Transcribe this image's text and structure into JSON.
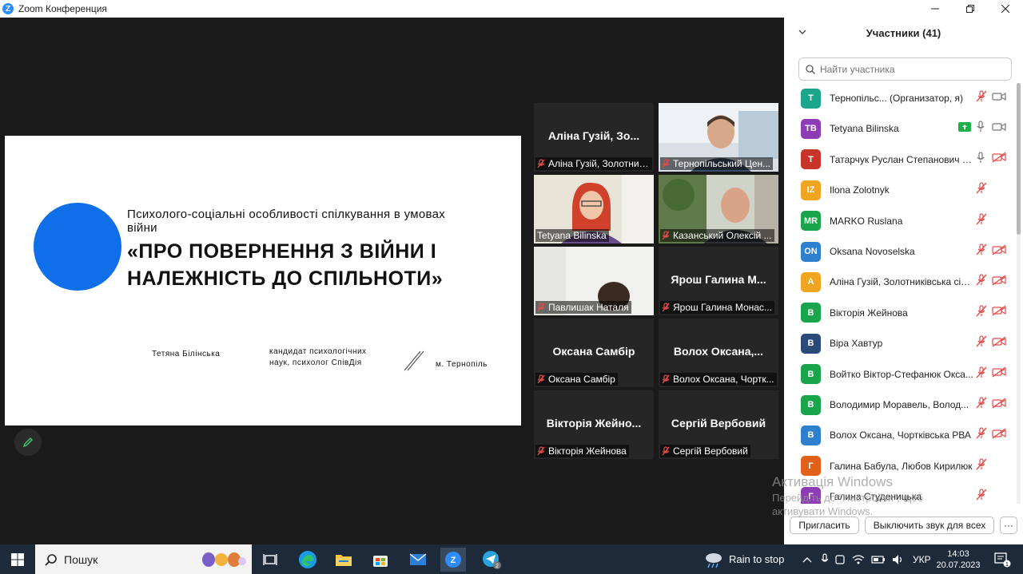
{
  "window": {
    "title": "Zoom Конференция"
  },
  "slide": {
    "subtitle": "Психолого-соціальні особливості спілкування в умовах війни",
    "title": "«ПРО ПОВЕРНЕННЯ З ВІЙНИ І НАЛЕЖНІСТЬ ДО СПІЛЬНОТИ»",
    "author": "Тетяна Білінська",
    "degree": "кандидат психологічних наук, психолог СпівДія",
    "city": "м. Тернопіль",
    "circle_color": "#0e6fe8"
  },
  "tiles": [
    {
      "display_name": "Аліна Гузій, Зо...",
      "label": "Аліна Гузій, Золотник...",
      "muted": true,
      "video": false
    },
    {
      "display_name": "",
      "label": "Тернопільський Цен...",
      "muted": true,
      "video": true
    },
    {
      "display_name": "",
      "label": "Tetyana Bilinska",
      "muted": false,
      "video": true,
      "active": true
    },
    {
      "display_name": "",
      "label": "Казанський Олексій ...",
      "muted": true,
      "video": true
    },
    {
      "display_name": "",
      "label": "Павлишак Наталя",
      "muted": true,
      "video": true
    },
    {
      "display_name": "Ярош Галина М...",
      "label": "Ярош Галина Монас...",
      "muted": true,
      "video": false
    },
    {
      "display_name": "Оксана Самбір",
      "label": "Оксана Самбір",
      "muted": true,
      "video": false
    },
    {
      "display_name": "Волох Оксана,...",
      "label": "Волох Оксана, Чортк...",
      "muted": true,
      "video": false
    },
    {
      "display_name": "Вікторія Жейно...",
      "label": "Вікторія Жейнова",
      "muted": true,
      "video": false
    },
    {
      "display_name": "Сергій Вербовий",
      "label": "Сергій Вербовий",
      "muted": true,
      "video": false
    }
  ],
  "panel": {
    "title": "Участники (41)",
    "search_placeholder": "Найти участника",
    "participants": [
      {
        "initials": "Т",
        "color": "#1aa58c",
        "name": "Тернопільс...  (Организатор, я)",
        "mic": "muted",
        "cam": "on"
      },
      {
        "initials": "TB",
        "color": "#8e3cb5",
        "name": "Tetyana Bilinska",
        "share": true,
        "mic": "on",
        "cam": "on"
      },
      {
        "initials": "Т",
        "color": "#c8342a",
        "name": "Татарчук Руслан Степанович З...",
        "mic": "on",
        "cam": "off"
      },
      {
        "initials": "IZ",
        "color": "#f0a41f",
        "name": "Ilona Zolotnyk",
        "mic": "muted",
        "cam": "none"
      },
      {
        "initials": "MR",
        "color": "#1aa54c",
        "name": "MARKO Ruslana",
        "mic": "muted",
        "cam": "none"
      },
      {
        "initials": "ON",
        "color": "#2f7fcf",
        "name": "Oksana Novoselska",
        "mic": "muted",
        "cam": "off"
      },
      {
        "initials": "А",
        "color": "#f0a41f",
        "name": "Аліна Гузій, Золотниківська сіл...",
        "mic": "muted",
        "cam": "off"
      },
      {
        "initials": "В",
        "color": "#1aa54c",
        "name": "Вікторія Жейнова",
        "mic": "muted",
        "cam": "off"
      },
      {
        "initials": "В",
        "color": "#2b4a7a",
        "name": "Віра Хавтур",
        "mic": "muted",
        "cam": "off"
      },
      {
        "initials": "В",
        "color": "#1aa54c",
        "name": "Войтко Віктор-Стефанюк Окса...",
        "mic": "muted",
        "cam": "off"
      },
      {
        "initials": "В",
        "color": "#1aa54c",
        "name": "Володимир Моравель, Волод...",
        "mic": "muted",
        "cam": "off"
      },
      {
        "initials": "В",
        "color": "#2f7fcf",
        "name": "Волох Оксана, Чортківська РВА",
        "mic": "muted",
        "cam": "off"
      },
      {
        "initials": "Г",
        "color": "#e0621a",
        "name": "Галина Бабула, Любов Кирилюк",
        "mic": "muted",
        "cam": "none"
      },
      {
        "initials": "Г",
        "color": "#8e3cb5",
        "name": "Галина Студеницька",
        "mic": "muted",
        "cam": "none"
      }
    ],
    "invite_label": "Пригласить",
    "mute_all_label": "Выключить звук для всех",
    "more_label": "···"
  },
  "watermark": {
    "line1": "Активація Windows",
    "line2": "Перейдіть до \"Настройки\", щоб",
    "line3": "активувати Windows."
  },
  "taskbar": {
    "search_label": "Пошук",
    "weather": "Rain to stop",
    "lang": "УКР",
    "time": "14:03",
    "date": "20.07.2023",
    "telegram_badge": "2",
    "notif_badge": "1"
  }
}
